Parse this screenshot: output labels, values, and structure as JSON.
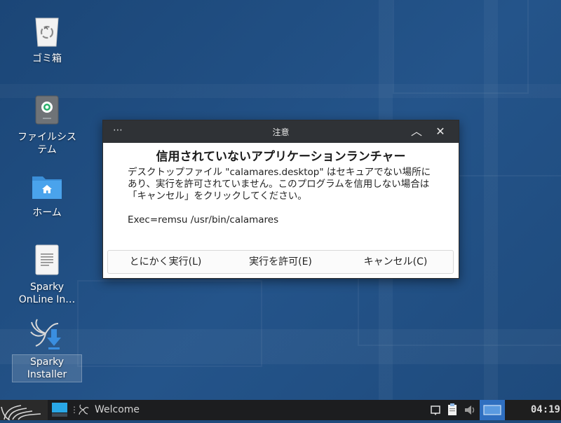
{
  "desktop": {
    "icons": [
      {
        "name": "trash-icon",
        "label": "ゴミ箱"
      },
      {
        "name": "filesystem-icon",
        "label": "ファイルシステム"
      },
      {
        "name": "home-folder-icon",
        "label": "ホーム"
      },
      {
        "name": "document-icon",
        "label": "Sparky OnLine In…"
      },
      {
        "name": "installer-icon",
        "label": "Sparky Installer"
      }
    ]
  },
  "dialog": {
    "menu_glyph": "⋯",
    "title": "注意",
    "heading": "信用されていないアプリケーションランチャー",
    "message": "デスクトップファイル \"calamares.desktop\" はセキュアでない場所にあり、実行を許可されていません。このプログラムを信用しない場合は「キャンセル」をクリックしてください。",
    "exec_line": "Exec=remsu /usr/bin/calamares",
    "buttons": {
      "run_anyway": "とにかく実行(L)",
      "allow_run": "実行を許可(E)",
      "cancel": "キャンセル(C)"
    },
    "minimize_glyph": "︿",
    "close_glyph": "✕"
  },
  "taskbar": {
    "task_label": "Welcome",
    "clock": "04:19"
  }
}
